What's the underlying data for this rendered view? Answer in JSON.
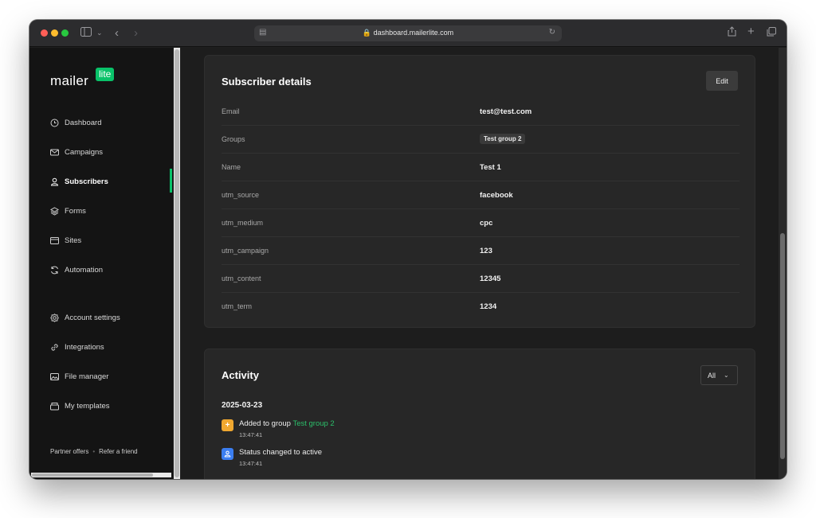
{
  "browser": {
    "url": "dashboard.mailerlite.com"
  },
  "logo": {
    "word": "mailer",
    "badge": "lite"
  },
  "sidebar": {
    "items": [
      {
        "label": "Dashboard",
        "icon": "clock-icon"
      },
      {
        "label": "Campaigns",
        "icon": "envelope-icon"
      },
      {
        "label": "Subscribers",
        "icon": "user-icon",
        "active": true
      },
      {
        "label": "Forms",
        "icon": "layers-icon"
      },
      {
        "label": "Sites",
        "icon": "browser-icon"
      },
      {
        "label": "Automation",
        "icon": "refresh-icon"
      }
    ],
    "secondary_items": [
      {
        "label": "Account settings",
        "icon": "gear-icon"
      },
      {
        "label": "Integrations",
        "icon": "link-icon"
      },
      {
        "label": "File manager",
        "icon": "image-icon"
      },
      {
        "label": "My templates",
        "icon": "template-icon"
      }
    ],
    "footer": {
      "partner": "Partner offers",
      "refer": "Refer a friend"
    }
  },
  "subscriber_details": {
    "title": "Subscriber details",
    "edit_label": "Edit",
    "rows": [
      {
        "key": "Email",
        "value": "test@test.com"
      },
      {
        "key": "Groups",
        "value": "Test group 2",
        "is_tag": true
      },
      {
        "key": "Name",
        "value": "Test 1"
      },
      {
        "key": "utm_source",
        "value": "facebook"
      },
      {
        "key": "utm_medium",
        "value": "cpc"
      },
      {
        "key": "utm_campaign",
        "value": "123"
      },
      {
        "key": "utm_content",
        "value": "12345"
      },
      {
        "key": "utm_term",
        "value": "1234"
      }
    ]
  },
  "activity": {
    "title": "Activity",
    "filter_label": "All",
    "date": "2025-03-23",
    "events": [
      {
        "text": "Added to group ",
        "link": "Test group 2",
        "time": "13:47:41",
        "icon": "plus-icon",
        "color": "#f0a830"
      },
      {
        "text": "Status changed to active",
        "link": "",
        "time": "13:47:41",
        "icon": "person-status-icon",
        "color": "#3b7ef0"
      }
    ]
  },
  "colors": {
    "brand_green": "#09c269"
  }
}
